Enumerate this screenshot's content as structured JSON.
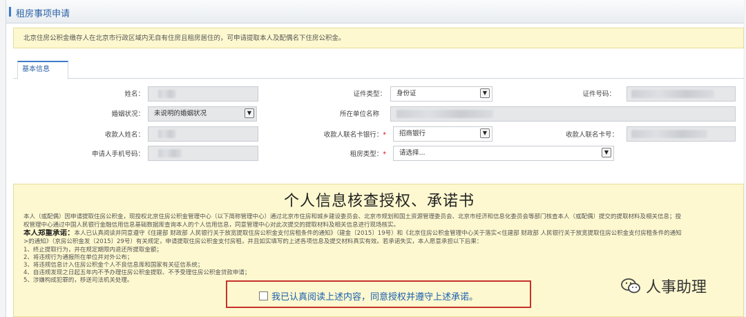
{
  "header": {
    "title": "租房事项申请"
  },
  "notice": {
    "text": "北京住房公积金缴存人在北京市行政区域内无自有住房且租房居住的，可申请提取本人及配偶名下住房公积金。"
  },
  "tabs": [
    {
      "label": "基本信息"
    }
  ],
  "form": {
    "name": {
      "label": "姓名："
    },
    "id_type": {
      "label": "证件类型：",
      "value": "身份证"
    },
    "id_number": {
      "label": "证件号码："
    },
    "marital": {
      "label": "婚姻状况：",
      "value": "未说明的婚姻状况"
    },
    "employer": {
      "label": "所在单位名称"
    },
    "payee_name": {
      "label": "收款人姓名："
    },
    "bank": {
      "label": "收款人联名卡银行：",
      "value": "招商银行"
    },
    "card_no": {
      "label": "收款人联名卡号："
    },
    "phone": {
      "label": "申请人手机号码："
    },
    "rent_type": {
      "label": "租房类型：",
      "value": "请选择..."
    }
  },
  "consent": {
    "heading": "个人信息核查授权、承诺书",
    "para1": "本人（或配偶）因申请提取住房公积金，现授权北京住房公积金管理中心（以下简称管理中心）通过北京市住房和城乡建设委员会、北京市规划和国土资源管理委员会、北京市经济和信息化委员会等部门核查本人（或配偶）提交的提取材料及相关信息；授",
    "para2": "权管理中心通过中国人民银行金融信用信息基础数据库查询本人的个人信用信息，同意管理中心对此次提交的提取材料及相关信息进行现场核实。",
    "promise_lead": "本人郑重承诺：",
    "para3": "本人已认真阅读并同意遵守《住建部 财政部 人民银行关于放宽提取住房公积金支付房租条件的通知》（建金〔2015〕19号）和《北京住房公积金管理中心关于落实<住建部 财政部 人民银行关于放宽提取住房公积金支付房租条件的通知",
    "para4": ">的通知》（京房公积金发〔2015〕29号）有关规定，申请提取住房公积金支付房租，并且如实填写的上述各项信息及提交材料真实有效。若承诺失实，本人愿意承担以下后果：",
    "items": [
      "1、终止提取行为，并在规定期限内退还所提取金额；",
      "2、将违规行为通报所在单位并对外公布；",
      "3、将违规信息计入住房公积金个人不良信息库和国家有关征信系统；",
      "4、自违规发现之日起五年内不予办理住房公积金提取、不予受理住房公积金贷款申请；",
      "5、涉嫌构成犯罪的，移送司法机关处理。"
    ],
    "agree_text": "我已认真阅读上述内容，同意授权并遵守上述承诺。"
  },
  "watermark": {
    "text": "人事助理"
  }
}
